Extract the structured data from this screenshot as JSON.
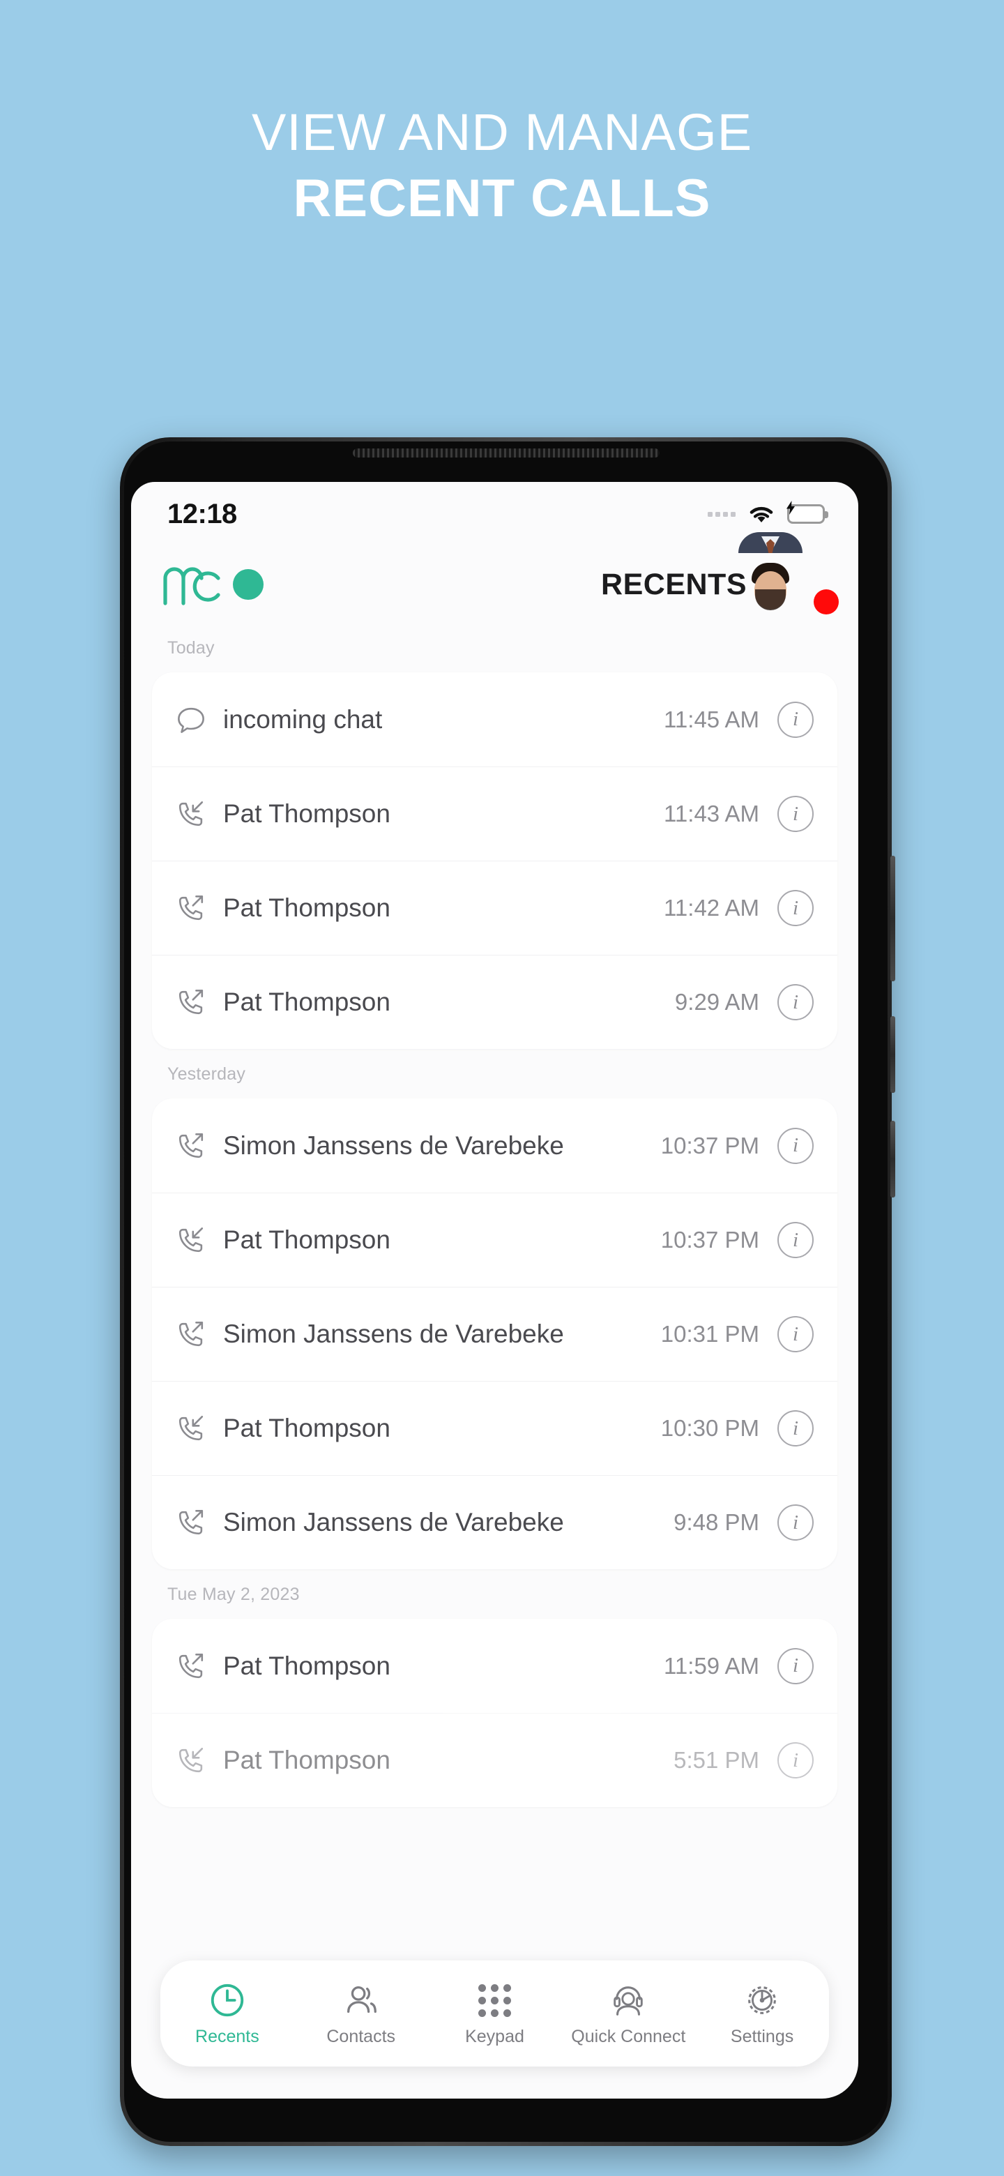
{
  "promo": {
    "line1": "VIEW AND MANAGE",
    "line2": "RECENT CALLS"
  },
  "colors": {
    "background": "#9BCCE8",
    "accent_green": "#2FB894",
    "badge_red": "#FF0A0A",
    "battery_green": "#25D366",
    "text_primary": "#4A4A4F",
    "text_muted": "#8D8D92",
    "section_label": "#B6B6BB"
  },
  "status_bar": {
    "time": "12:18",
    "signal_icon": "signal-dots-icon",
    "wifi_icon": "wifi-icon",
    "battery_icon": "battery-charging-icon"
  },
  "app_header": {
    "logo_icon": "mc-logo-icon",
    "presence_icon": "presence-dot-icon",
    "title": "RECENTS",
    "avatar_icon": "user-avatar",
    "avatar_badge_icon": "status-badge-icon"
  },
  "sections": [
    {
      "label": "Today",
      "rows": [
        {
          "name": "incoming chat",
          "time": "11:45 AM",
          "icon": "chat-bubble-icon",
          "type": "chat"
        },
        {
          "name": "Pat Thompson",
          "time": "11:43 AM",
          "icon": "call-incoming-icon",
          "type": "incoming"
        },
        {
          "name": "Pat Thompson",
          "time": "11:42 AM",
          "icon": "call-outgoing-icon",
          "type": "outgoing"
        },
        {
          "name": "Pat Thompson",
          "time": "9:29 AM",
          "icon": "call-outgoing-icon",
          "type": "outgoing"
        }
      ]
    },
    {
      "label": "Yesterday",
      "rows": [
        {
          "name": "Simon Janssens de Varebeke",
          "time": "10:37 PM",
          "icon": "call-outgoing-icon",
          "type": "outgoing"
        },
        {
          "name": "Pat Thompson",
          "time": "10:37 PM",
          "icon": "call-incoming-icon",
          "type": "incoming"
        },
        {
          "name": "Simon Janssens de Varebeke",
          "time": "10:31 PM",
          "icon": "call-outgoing-icon",
          "type": "outgoing"
        },
        {
          "name": "Pat Thompson",
          "time": "10:30 PM",
          "icon": "call-incoming-icon",
          "type": "incoming"
        },
        {
          "name": "Simon Janssens de Varebeke",
          "time": "9:48 PM",
          "icon": "call-outgoing-icon",
          "type": "outgoing"
        }
      ]
    },
    {
      "label": "Tue May 2, 2023",
      "rows": [
        {
          "name": "Pat Thompson",
          "time": "11:59 AM",
          "icon": "call-outgoing-icon",
          "type": "outgoing"
        },
        {
          "name": "Pat Thompson",
          "time": "5:51 PM",
          "icon": "call-incoming-icon",
          "type": "incoming"
        }
      ]
    }
  ],
  "tabbar": {
    "active": "Recents",
    "tabs": [
      {
        "label": "Recents",
        "icon": "clock-icon"
      },
      {
        "label": "Contacts",
        "icon": "people-icon"
      },
      {
        "label": "Keypad",
        "icon": "dialpad-icon"
      },
      {
        "label": "Quick Connect",
        "icon": "headset-agent-icon"
      },
      {
        "label": "Settings",
        "icon": "gear-icon"
      }
    ]
  }
}
